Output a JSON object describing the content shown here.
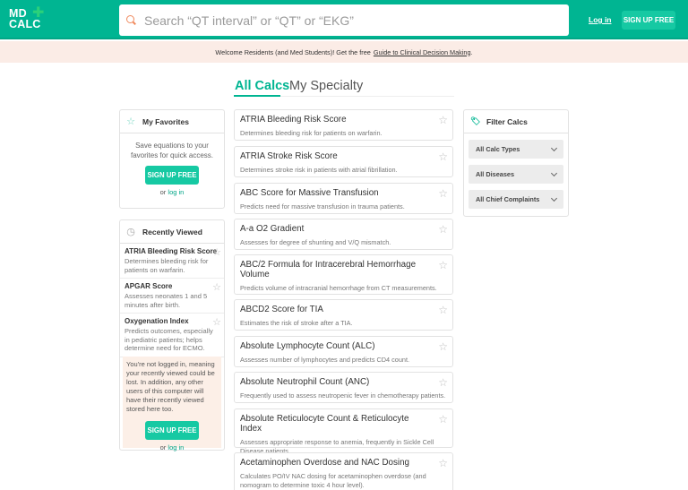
{
  "header": {
    "logo_line1": "MD",
    "logo_line2": "CALC",
    "logo_plus": "✚",
    "search_placeholder": "Search “QT interval” or “QT” or “EKG”",
    "login_label": "Log in",
    "signup_label": "SIGN UP FREE"
  },
  "banner": {
    "text": "Welcome Residents (and Med Students)! Get the free",
    "link": "Guide to Clinical Decision Making",
    "suffix": "."
  },
  "tabs": [
    {
      "label": "All Calcs",
      "active": true
    },
    {
      "label": "My Specialty",
      "active": false
    }
  ],
  "favorites": {
    "title": "My Favorites",
    "text": "Save equations to your favorites for quick access.",
    "signup_label": "SIGN UP FREE",
    "or": "or",
    "login": "log in"
  },
  "recent": {
    "title": "Recently Viewed",
    "items": [
      {
        "title": "ATRIA Bleeding Risk Score",
        "desc": "Determines bleeding risk for patients on warfarin."
      },
      {
        "title": "APGAR Score",
        "desc": "Assesses neonates 1 and 5 minutes after birth."
      },
      {
        "title": "Oxygenation Index",
        "desc": "Predicts outcomes, especially in pediatric patients; helps determine need for ECMO."
      }
    ],
    "notice": "You're not logged in, meaning your recently viewed could be lost.  In addition, any other users of this computer will have their recently viewed stored here too.",
    "signup_label": "SIGN UP FREE",
    "or": "or",
    "login": "log in"
  },
  "calcs": [
    {
      "title": "ATRIA Bleeding Risk Score",
      "desc": "Determines bleeding risk for patients on warfarin."
    },
    {
      "title": "ATRIA Stroke Risk Score",
      "desc": "Determines stroke risk in patients with atrial fibrillation."
    },
    {
      "title": "ABC Score for Massive Transfusion",
      "desc": "Predicts need for massive transfusion in trauma patients."
    },
    {
      "title": "A-a O2 Gradient",
      "desc": "Assesses for degree of shunting and V/Q mismatch."
    },
    {
      "title": "ABC/2 Formula for Intracerebral Hemorrhage Volume",
      "desc": "Predicts volume of intracranial hemorrhage from CT measurements."
    },
    {
      "title": "ABCD2 Score for TIA",
      "desc": "Estimates the risk of stroke after a TIA."
    },
    {
      "title": "Absolute Lymphocyte Count (ALC)",
      "desc": "Assesses number of lymphocytes and predicts CD4 count."
    },
    {
      "title": "Absolute Neutrophil Count (ANC)",
      "desc": "Frequently used to assess neutropenic fever in chemotherapy patients."
    },
    {
      "title": "Absolute Reticulocyte Count & Reticulocyte Index",
      "desc": "Assesses appropriate response to anemia, frequently in Sickle Cell Disease patients."
    },
    {
      "title": "Acetaminophen Overdose and NAC Dosing",
      "desc": "Calculates PO/IV NAC dosing for acetaminophen overdose (and nomogram to determine toxic 4 hour level)."
    }
  ],
  "filter": {
    "title": "Filter Calcs",
    "options": [
      "All Calc Types",
      "All Diseases",
      "All Chief Complaints"
    ]
  },
  "icons": {
    "star": "☆",
    "clock": "◷",
    "tag": "🏷"
  }
}
